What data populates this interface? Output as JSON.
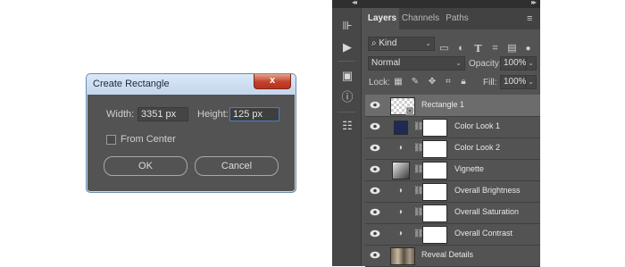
{
  "dialog": {
    "title": "Create Rectangle",
    "close_glyph": "x",
    "width_label": "Width:",
    "width_value": "3351 px",
    "height_label": "Height:",
    "height_value": "125 px",
    "from_center_label": "From Center",
    "from_center_checked": false,
    "ok_label": "OK",
    "cancel_label": "Cancel"
  },
  "panel": {
    "tabs": [
      {
        "label": "Layers",
        "active": true
      },
      {
        "label": "Channels",
        "active": false
      },
      {
        "label": "Paths",
        "active": false
      }
    ],
    "filter": {
      "kind_label": "Kind",
      "icons": [
        "image-filter-icon",
        "adjustment-filter-icon",
        "type-filter-icon",
        "shape-filter-icon",
        "smart-object-filter-icon",
        "filter-toggle-icon"
      ]
    },
    "blend_mode": "Normal",
    "opacity_label": "Opacity:",
    "opacity_value": "100%",
    "lock_label": "Lock:",
    "fill_label": "Fill:",
    "fill_value": "100%",
    "layers": [
      {
        "name": "Rectangle 1",
        "type": "shape",
        "selected": true
      },
      {
        "name": "Color Look 1",
        "type": "solid-color",
        "color": "#1e2a55"
      },
      {
        "name": "Color Look 2",
        "type": "adjustment"
      },
      {
        "name": "Vignette",
        "type": "gradient"
      },
      {
        "name": "Overall Brightness",
        "type": "adjustment"
      },
      {
        "name": "Overall Saturation",
        "type": "adjustment"
      },
      {
        "name": "Overall Contrast",
        "type": "adjustment"
      },
      {
        "name": "Reveal Details",
        "type": "image"
      }
    ]
  }
}
